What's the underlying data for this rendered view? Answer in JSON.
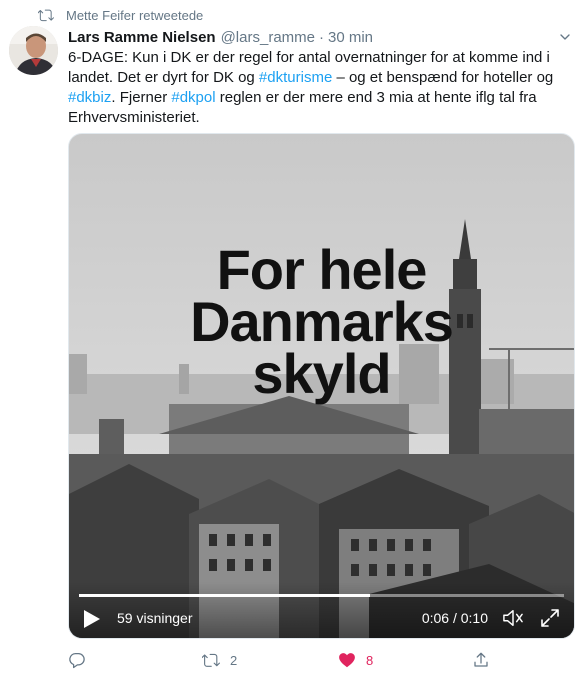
{
  "retweet_notice": {
    "text": "Mette Feifer retweetede"
  },
  "tweet": {
    "author_name": "Lars Ramme Nielsen",
    "handle": "@lars_ramme",
    "separator": "·",
    "time": "30 min",
    "text_lines": [
      {
        "parts": [
          "6-DAGE: Kun i DK er der regel for antal overnatninger for at komme ind i"
        ]
      },
      {
        "parts": [
          "landet. Det er dyrt for DK og ",
          "#dkturisme",
          " – og et benspænd for hoteller og"
        ]
      },
      {
        "parts": [
          "#dkbiz",
          ". Fjerner ",
          "#dkpol",
          " reglen er der mere end 3 mia at hente iflg tal fra"
        ]
      },
      {
        "parts": [
          "Erhvervsministeriet."
        ]
      }
    ]
  },
  "video": {
    "overlay_lines": [
      "For hele",
      "Danmarks",
      "skyld"
    ],
    "views": "59 visninger",
    "timecode": "0:06 / 0:10",
    "progress": 0.6
  },
  "actions": {
    "reply_count": "",
    "retweet_count": "2",
    "like_count": "8",
    "like_color": "#e0245e"
  },
  "colors": {
    "link": "#1da1f2",
    "secondary": "#657786"
  }
}
